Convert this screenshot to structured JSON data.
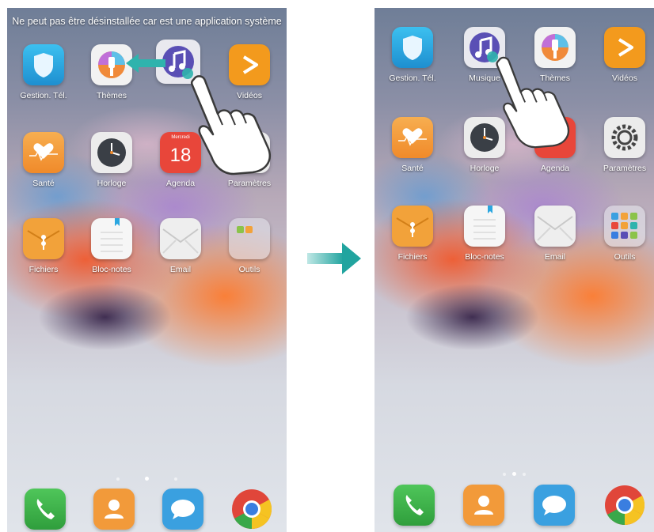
{
  "left_screen": {
    "notice": "Ne peut pas être désinstallée car est une application système",
    "apps": [
      {
        "label": "Gestion. Tél.",
        "icon": "shield-icon"
      },
      {
        "label": "Thèmes",
        "icon": "paintbrush-icon"
      },
      {
        "label": "",
        "icon": "music-note-icon"
      },
      {
        "label": "Vidéos",
        "icon": "play-icon"
      },
      {
        "label": "Santé",
        "icon": "heart-icon"
      },
      {
        "label": "Horloge",
        "icon": "clock-icon"
      },
      {
        "label": "Agenda",
        "icon": "calendar-icon",
        "calendar_day": "Mercredi",
        "calendar_date": "18"
      },
      {
        "label": "Paramètres",
        "icon": "gear-icon"
      },
      {
        "label": "Fichiers",
        "icon": "folder-icon"
      },
      {
        "label": "Bloc-notes",
        "icon": "notepad-icon"
      },
      {
        "label": "Email",
        "icon": "envelope-icon"
      },
      {
        "label": "Outils",
        "icon": "tools-folder-icon"
      }
    ],
    "dock": [
      "phone-icon",
      "contacts-icon",
      "messages-icon",
      "chrome-icon"
    ],
    "page_indicator": {
      "pages": 3,
      "current": 2
    }
  },
  "right_screen": {
    "apps": [
      {
        "label": "Gestion. Tél.",
        "icon": "shield-icon"
      },
      {
        "label": "Musique",
        "icon": "music-note-icon"
      },
      {
        "label": "Thèmes",
        "icon": "paintbrush-icon"
      },
      {
        "label": "Vidéos",
        "icon": "play-icon"
      },
      {
        "label": "Santé",
        "icon": "heart-icon"
      },
      {
        "label": "Horloge",
        "icon": "clock-icon"
      },
      {
        "label": "Agenda",
        "icon": "calendar-icon"
      },
      {
        "label": "Paramètres",
        "icon": "gear-icon"
      },
      {
        "label": "Fichiers",
        "icon": "folder-icon"
      },
      {
        "label": "Bloc-notes",
        "icon": "notepad-icon"
      },
      {
        "label": "Email",
        "icon": "envelope-icon"
      },
      {
        "label": "Outils",
        "icon": "tools-folder-icon"
      }
    ],
    "dock": [
      "phone-icon",
      "contacts-icon",
      "messages-icon",
      "chrome-icon"
    ],
    "page_indicator": {
      "pages": 3,
      "current": 2
    }
  },
  "colors": {
    "accent_arrow": "#2fb3ad",
    "gestion": "#2aa6e0",
    "music": "#5a4fb5",
    "videos": "#f39a1d",
    "sante": "#f59a3a",
    "agenda": "#e8463a",
    "fichiers": "#f2a23a",
    "phone": "#3db34a",
    "contacts": "#f29a3a",
    "messages": "#3aa0e0"
  }
}
